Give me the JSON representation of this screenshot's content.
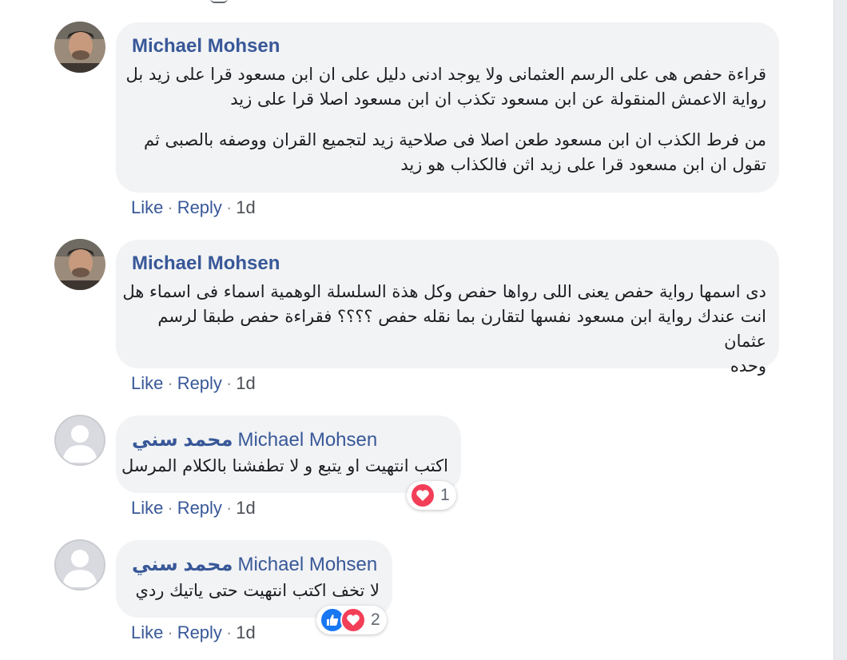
{
  "comments": [
    {
      "author": "Michael Mohsen",
      "avatar": "user-photo",
      "paragraphs": [
        [
          "قراءة حفص هى على الرسم العثمانى ولا يوجد ادنى دليل على ان ابن مسعود قرا على زيد بل",
          "رواية الاعمش المنقولة عن ابن مسعود تكذب ان ابن مسعود اصلا قرا على زيد"
        ],
        [
          "من فرط الكذب ان ابن مسعود طعن اصلا فى صلاحية زيد لتجميع القران ووصفه بالصبى ثم",
          "تقول ان ابن مسعود قرا على زيد اثن فالكذاب هو زيد"
        ]
      ],
      "actions": {
        "like": "Like",
        "reply": "Reply",
        "time": "1d"
      }
    },
    {
      "author": "Michael Mohsen",
      "avatar": "user-photo",
      "paragraphs": [
        [
          "دى اسمها رواية حفص يعنى اللى رواها حفص وكل هذة السلسلة الوهمية اسماء فى اسماء هل",
          "انت عندك رواية ابن مسعود نفسها لتقارن بما نقله حفص ؟؟؟؟ فقراءة حفص طبقا لرسم عثمان",
          "وحده"
        ]
      ],
      "actions": {
        "like": "Like",
        "reply": "Reply",
        "time": "1d"
      }
    },
    {
      "author_ar": "محمد سني",
      "tagged": "Michael Mohsen",
      "avatar": "default-avatar",
      "paragraphs": [
        [
          "اكتب انتهيت او يتبع و لا تطفشنا بالكلام المرسل"
        ]
      ],
      "reactions": {
        "icons": [
          "love-icon"
        ],
        "count": "1"
      },
      "actions": {
        "like": "Like",
        "reply": "Reply",
        "time": "1d"
      }
    },
    {
      "author_ar": "محمد سني",
      "tagged": "Michael Mohsen",
      "avatar": "default-avatar",
      "paragraphs": [
        [
          "لا تخف اكتب انتهيت حتى ياتيك ردي"
        ]
      ],
      "reactions": {
        "icons": [
          "like-icon",
          "love-icon"
        ],
        "count": "2"
      },
      "actions": {
        "like": "Like",
        "reply": "Reply",
        "time": "1d"
      }
    }
  ],
  "colors": {
    "link": "#385898",
    "bubble": "#f2f3f5",
    "love": "#f33e58",
    "like": "#1877f2"
  }
}
